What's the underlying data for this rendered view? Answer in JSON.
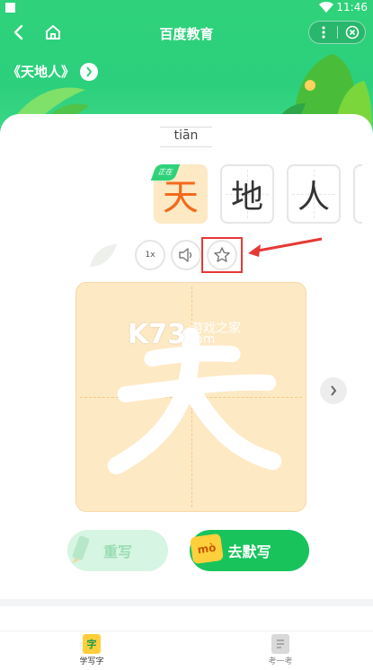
{
  "status_bar": {
    "time": "11:46"
  },
  "nav": {
    "title": "百度教育"
  },
  "lesson": {
    "title": "《天地人》"
  },
  "pinyin": "tiān",
  "characters": [
    {
      "char": "天",
      "badge": "正在",
      "active": true
    },
    {
      "char": "地",
      "active": false
    },
    {
      "char": "人",
      "active": false
    }
  ],
  "tools": {
    "speed_label": "1x"
  },
  "board": {
    "character": "天"
  },
  "watermark": {
    "brand": "K73",
    "sub": "游戏之家",
    "domain": ".com"
  },
  "buttons": {
    "rewrite": "重写",
    "dictation": "去默写",
    "dictation_badge": "mò"
  },
  "tabbar": {
    "learn": "学写字",
    "learn_icon": "字",
    "test": "考一考"
  },
  "colors": {
    "primary": "#2fd27a",
    "highlight": "#e53935",
    "active_char": "#f26a1b",
    "board_bg": "#fde9c4"
  }
}
